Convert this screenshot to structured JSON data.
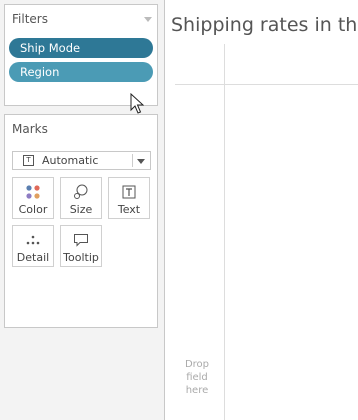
{
  "filters": {
    "title": "Filters",
    "pills": [
      "Ship Mode",
      "Region"
    ]
  },
  "marks": {
    "title": "Marks",
    "mark_type": "Automatic",
    "buttons": {
      "color": "Color",
      "size": "Size",
      "text": "Text",
      "detail": "Detail",
      "tooltip": "Tooltip"
    }
  },
  "canvas": {
    "title": "Shipping rates in th",
    "drop_hint": [
      "Drop",
      "field",
      "here"
    ]
  },
  "colors": {
    "pill_dark": "#2e7896",
    "pill_light": "#4b9bb5"
  },
  "icons": [
    "t-text-icon",
    "color-dots-icon",
    "size-icon",
    "text-icon",
    "detail-icon",
    "tooltip-icon",
    "cursor-icon"
  ]
}
